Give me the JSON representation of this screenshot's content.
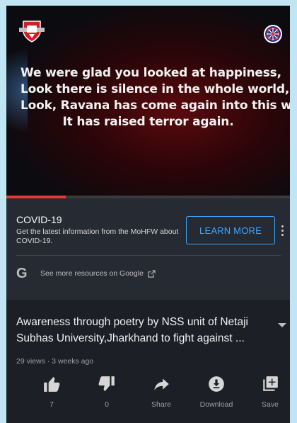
{
  "video": {
    "quote_lines": [
      "We were glad you looked at happiness,",
      "Look there is silence in the whole world,",
      "Look, Ravana has come again into this world,",
      "It has raised terror again."
    ],
    "logo_left": "nss-shield-logo-icon",
    "logo_right": "nss-wheel-logo-icon",
    "progress": 0.21,
    "progress_color": "#e53935"
  },
  "covid_panel": {
    "title": "COVID-19",
    "text": "Get the latest information from the MoHFW about COVID-19.",
    "button_label": "LEARN MORE",
    "button_color": "#3ea6ff",
    "google_link": "See more resources on Google"
  },
  "info": {
    "title_lines": [
      "Awareness through poetry by NSS unit of Netaji",
      "Subhas University,Jharkhand to fight against ..."
    ],
    "meta": "29 views · 3 weeks ago"
  },
  "actions": [
    {
      "icon": "thumbs-up-icon",
      "label": "7"
    },
    {
      "icon": "thumbs-down-icon",
      "label": "0"
    },
    {
      "icon": "share-icon",
      "label": "Share"
    },
    {
      "icon": "download-icon",
      "label": "Download"
    },
    {
      "icon": "save-icon",
      "label": "Save"
    }
  ]
}
